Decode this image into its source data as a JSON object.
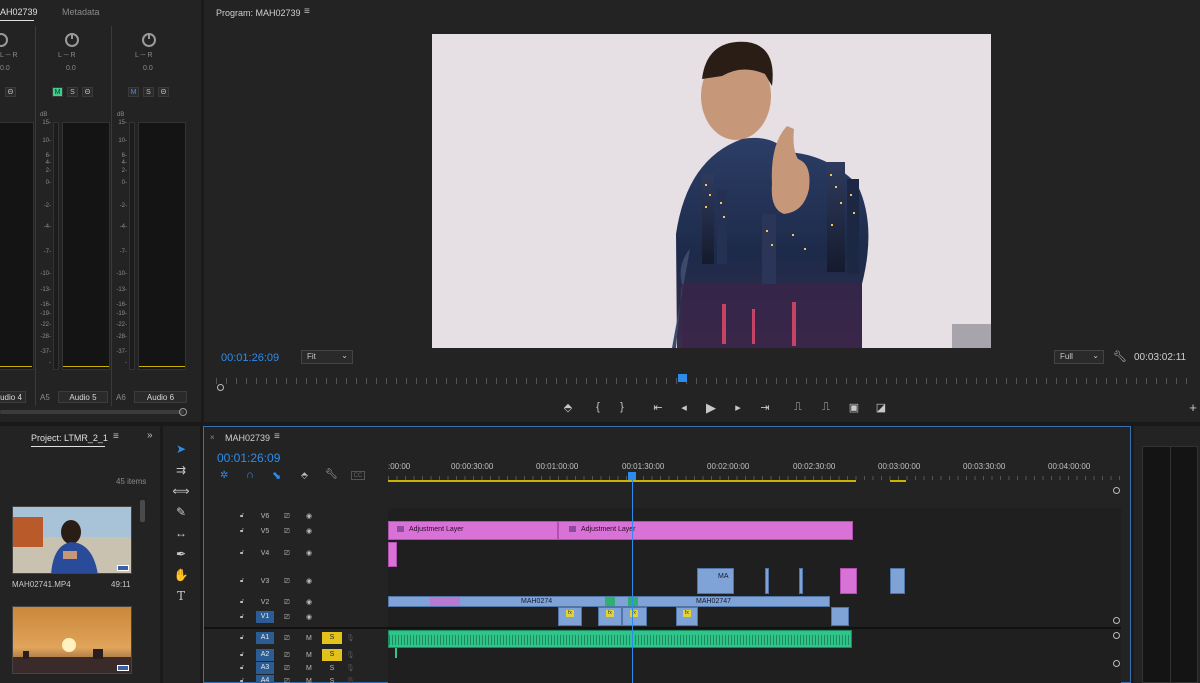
{
  "mixer": {
    "tab_partial": "AH02739",
    "tab_metadata": "Metadata",
    "pan_value": "0.0",
    "lr": "L ─ R",
    "db_label": "dB",
    "scale": [
      "15-",
      "10-",
      "6-",
      "4-",
      "2-",
      "0-",
      "-2-",
      "-4-",
      "-7-",
      "-10-",
      "-13-",
      "-16-",
      "-19-",
      "-22-",
      "-28-",
      "-37-",
      "-"
    ],
    "channels": [
      {
        "code": "",
        "name": "udio 4"
      },
      {
        "code": "A5",
        "name": "Audio 5"
      },
      {
        "code": "A6",
        "name": "Audio 6"
      }
    ],
    "msr": [
      "M",
      "S",
      "Θ"
    ]
  },
  "program": {
    "title": "Program: MAH02739",
    "timecode": "00:01:26:09",
    "fit": "Fit",
    "quality": "Full",
    "duration": "00:03:02:11"
  },
  "project": {
    "title": "Project: LTMR_2_1",
    "items_count": "45 items",
    "files": [
      {
        "name": "MAH02741.MP4",
        "duration": "49:11"
      }
    ]
  },
  "timeline": {
    "tab": "MAH02739",
    "timecode": "00:01:26:09",
    "ruler": [
      ":00:00",
      "00:00:30:00",
      "00:01:00:00",
      "00:01:30:00",
      "00:02:00:00",
      "00:02:30:00",
      "00:03:00:00",
      "00:03:30:00",
      "00:04:00:00"
    ],
    "tracks": [
      "V6",
      "V5",
      "V4",
      "V3",
      "V2",
      "V1",
      "A1",
      "A2",
      "A3",
      "A4"
    ],
    "clips": {
      "adj1": "Adjustment Layer",
      "adj2": "Adjustment Layer",
      "ma": "MA",
      "mah0274": "MAH0274",
      "mah02747": "MAH02747"
    },
    "track_m": "M",
    "track_s": "S",
    "fx": "fx"
  },
  "colors": {
    "accent_blue": "#2d8ceb",
    "clip_pink": "#d872d6",
    "clip_blue": "#7fa3d6",
    "clip_green": "#2ec48a",
    "solo_yellow": "#e3c21c",
    "mute_green": "#3ecf8e"
  }
}
